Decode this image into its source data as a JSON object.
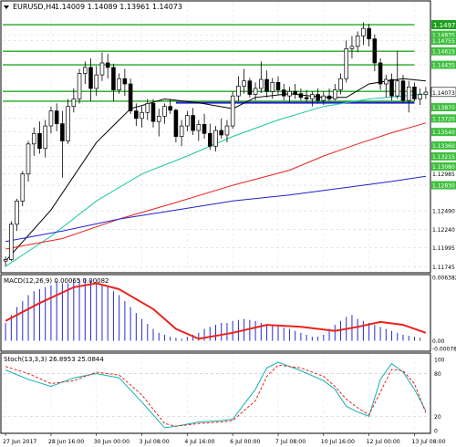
{
  "chart_data": [
    {
      "panel": "price",
      "type": "candlestick",
      "title": "EURUSD,H4",
      "ohlc_header": "1.14009 1.14089 1.13961 1.14073",
      "ylim": [
        1.117,
        1.1525
      ],
      "y_ticks": [
        {
          "value": 1.1497,
          "label": "1.1497",
          "style": "highlight"
        },
        {
          "value": 1.14835,
          "label": "1.14835",
          "style": "green"
        },
        {
          "value": 1.14755,
          "label": "1.14755",
          "style": "green"
        },
        {
          "value": 1.14615,
          "label": "1.14615",
          "style": "green"
        },
        {
          "value": 1.14435,
          "label": "1.14435",
          "style": "green"
        },
        {
          "value": 1.14073,
          "label": "1.14073",
          "style": "price"
        },
        {
          "value": 1.1387,
          "label": "1.13870",
          "style": "green"
        },
        {
          "value": 1.1372,
          "label": "1.13720",
          "style": "green"
        },
        {
          "value": 1.1354,
          "label": "1.13540",
          "style": "green"
        },
        {
          "value": 1.1336,
          "label": "1.13360",
          "style": "green"
        },
        {
          "value": 1.13215,
          "label": "1.13215",
          "style": "green"
        },
        {
          "value": 1.1308,
          "label": "1.13080",
          "style": "green"
        },
        {
          "value": 1.12985,
          "label": "1.12985",
          "style": "plain"
        },
        {
          "value": 1.1283,
          "label": "1.12830",
          "style": "green"
        },
        {
          "value": 1.1249,
          "label": "1.12490",
          "style": "plain"
        },
        {
          "value": 1.1224,
          "label": "1.12240",
          "style": "plain"
        },
        {
          "value": 1.11995,
          "label": "1.11995",
          "style": "plain"
        },
        {
          "value": 1.11745,
          "label": "1.11745",
          "style": "plain"
        }
      ],
      "candles": [
        [
          1.1182,
          1.1188,
          1.1175,
          1.1184
        ],
        [
          1.1184,
          1.1235,
          1.1182,
          1.1231
        ],
        [
          1.1231,
          1.1265,
          1.1222,
          1.1262
        ],
        [
          1.1262,
          1.1302,
          1.1255,
          1.1298
        ],
        [
          1.1298,
          1.1342,
          1.1288,
          1.1338
        ],
        [
          1.1338,
          1.136,
          1.1322,
          1.1352
        ],
        [
          1.1352,
          1.1368,
          1.1325,
          1.1332
        ],
        [
          1.1332,
          1.137,
          1.132,
          1.1362
        ],
        [
          1.1362,
          1.1388,
          1.1352,
          1.1382
        ],
        [
          1.1382,
          1.1392,
          1.1355,
          1.1365
        ],
        [
          1.1365,
          1.1382,
          1.1293,
          1.1342
        ],
        [
          1.1342,
          1.1398,
          1.1338,
          1.1388
        ],
        [
          1.1388,
          1.1412,
          1.138,
          1.1398
        ],
        [
          1.1398,
          1.1438,
          1.1392,
          1.1432
        ],
        [
          1.1432,
          1.1448,
          1.1418,
          1.144
        ],
        [
          1.144,
          1.1452,
          1.1395,
          1.1412
        ],
        [
          1.1412,
          1.1442,
          1.1402,
          1.143
        ],
        [
          1.143,
          1.146,
          1.1422,
          1.1446
        ],
        [
          1.1446,
          1.1458,
          1.1425,
          1.144
        ],
        [
          1.144,
          1.1445,
          1.1395,
          1.141
        ],
        [
          1.141,
          1.1432,
          1.1405,
          1.1425
        ],
        [
          1.1425,
          1.1438,
          1.1402,
          1.1418
        ],
        [
          1.1418,
          1.1425,
          1.1378,
          1.1382
        ],
        [
          1.1382,
          1.1392,
          1.1362,
          1.1372
        ],
        [
          1.1372,
          1.1388,
          1.136,
          1.138
        ],
        [
          1.138,
          1.1398,
          1.137,
          1.1392
        ],
        [
          1.1392,
          1.1398,
          1.136,
          1.1368
        ],
        [
          1.1368,
          1.1385,
          1.1348,
          1.1375
        ],
        [
          1.1375,
          1.1392,
          1.1365,
          1.1388
        ],
        [
          1.1388,
          1.1398,
          1.1378,
          1.1383
        ],
        [
          1.1383,
          1.1385,
          1.134,
          1.1348
        ],
        [
          1.1348,
          1.137,
          1.1335,
          1.1362
        ],
        [
          1.1362,
          1.1382,
          1.1355,
          1.1376
        ],
        [
          1.1376,
          1.1386,
          1.135,
          1.1356
        ],
        [
          1.1356,
          1.137,
          1.1342,
          1.1364
        ],
        [
          1.1364,
          1.1378,
          1.1345,
          1.1352
        ],
        [
          1.1352,
          1.1365,
          1.133,
          1.1335
        ],
        [
          1.1335,
          1.1362,
          1.1328,
          1.1356
        ],
        [
          1.1356,
          1.1372,
          1.1345,
          1.135
        ],
        [
          1.135,
          1.137,
          1.134,
          1.1362
        ],
        [
          1.1362,
          1.1408,
          1.1358,
          1.1402
        ],
        [
          1.1402,
          1.1428,
          1.1395,
          1.1415
        ],
        [
          1.1415,
          1.1438,
          1.1405,
          1.1422
        ],
        [
          1.1422,
          1.1426,
          1.14,
          1.1404
        ],
        [
          1.1404,
          1.142,
          1.1396,
          1.1412
        ],
        [
          1.1412,
          1.1448,
          1.1406,
          1.1424
        ],
        [
          1.1424,
          1.1436,
          1.14,
          1.1408
        ],
        [
          1.1408,
          1.1426,
          1.1398,
          1.142
        ],
        [
          1.142,
          1.1428,
          1.1404,
          1.141
        ],
        [
          1.141,
          1.1418,
          1.1396,
          1.1402
        ],
        [
          1.1402,
          1.1414,
          1.1393,
          1.1408
        ],
        [
          1.1408,
          1.1418,
          1.1398,
          1.1405
        ],
        [
          1.1405,
          1.1412,
          1.1396,
          1.14
        ],
        [
          1.14,
          1.141,
          1.1394,
          1.1398
        ],
        [
          1.1398,
          1.1408,
          1.1388,
          1.1404
        ],
        [
          1.1404,
          1.1412,
          1.1392,
          1.1396
        ],
        [
          1.1396,
          1.1408,
          1.139,
          1.1402
        ],
        [
          1.1402,
          1.1412,
          1.1395,
          1.1398
        ],
        [
          1.1398,
          1.1418,
          1.1396,
          1.141
        ],
        [
          1.141,
          1.1432,
          1.1404,
          1.1425
        ],
        [
          1.1425,
          1.1476,
          1.142,
          1.1465
        ],
        [
          1.1465,
          1.1482,
          1.1452,
          1.1468
        ],
        [
          1.1468,
          1.1488,
          1.146,
          1.1482
        ],
        [
          1.1482,
          1.15,
          1.147,
          1.1492
        ],
        [
          1.1492,
          1.1498,
          1.1468,
          1.1478
        ],
        [
          1.1478,
          1.1484,
          1.1435,
          1.1446
        ],
        [
          1.1446,
          1.1452,
          1.141,
          1.1418
        ],
        [
          1.1418,
          1.143,
          1.14,
          1.1424
        ],
        [
          1.1424,
          1.1432,
          1.1396,
          1.1402
        ],
        [
          1.1402,
          1.1462,
          1.1398,
          1.1422
        ],
        [
          1.1422,
          1.143,
          1.1392,
          1.1396
        ],
        [
          1.1396,
          1.1422,
          1.138,
          1.1414
        ],
        [
          1.1414,
          1.142,
          1.1395,
          1.1398
        ],
        [
          1.1398,
          1.1412,
          1.139,
          1.1404
        ],
        [
          1.1404,
          1.1414,
          1.1398,
          1.1407
        ]
      ],
      "lines": [
        {
          "name": "",
          "color": "#000000",
          "values": [
            [
              0,
              1.1182
            ],
            [
              8,
              1.125
            ],
            [
              16,
              1.134
            ],
            [
              22,
              1.1385
            ],
            [
              28,
              1.1398
            ],
            [
              34,
              1.1393
            ],
            [
              40,
              1.1385
            ],
            [
              44,
              1.14
            ],
            [
              50,
              1.1405
            ],
            [
              56,
              1.14
            ],
            [
              60,
              1.14
            ],
            [
              64,
              1.1418
            ],
            [
              70,
              1.1425
            ],
            [
              74,
              1.1422
            ]
          ]
        },
        {
          "name": "",
          "color": "#18c8a0",
          "values": [
            [
              0,
              1.1175
            ],
            [
              8,
              1.1215
            ],
            [
              16,
              1.1262
            ],
            [
              24,
              1.1298
            ],
            [
              32,
              1.1322
            ],
            [
              40,
              1.1348
            ],
            [
              48,
              1.137
            ],
            [
              56,
              1.1388
            ],
            [
              64,
              1.1398
            ],
            [
              70,
              1.1402
            ],
            [
              74,
              1.1405
            ]
          ]
        },
        {
          "name": "",
          "color": "#e8231c",
          "values": [
            [
              0,
              1.1198
            ],
            [
              10,
              1.1212
            ],
            [
              20,
              1.1238
            ],
            [
              30,
              1.126
            ],
            [
              40,
              1.1283
            ],
            [
              50,
              1.1303
            ],
            [
              56,
              1.1322
            ],
            [
              62,
              1.1338
            ],
            [
              68,
              1.1353
            ],
            [
              74,
              1.1366
            ]
          ]
        },
        {
          "name": "",
          "color": "#1e22cc",
          "values": [
            [
              0,
              1.1208
            ],
            [
              10,
              1.1222
            ],
            [
              20,
              1.1238
            ],
            [
              30,
              1.125
            ],
            [
              40,
              1.1262
            ],
            [
              50,
              1.127
            ],
            [
              60,
              1.128
            ],
            [
              68,
              1.1288
            ],
            [
              74,
              1.1295
            ]
          ]
        }
      ],
      "h_lines": [
        {
          "value": 1.1497,
          "color": "#22a822"
        },
        {
          "value": 1.14615,
          "color": "#22a822"
        },
        {
          "value": 1.14435,
          "color": "#22a822"
        },
        {
          "value": 1.1408,
          "color": "#22a822"
        },
        {
          "value": 1.1395,
          "color": "#22a822"
        },
        {
          "value": 1.1393,
          "color": "#1e22cc"
        }
      ],
      "x_tick_labels": [
        "27 Jun 2017",
        "28 Jun 16:00",
        "30 Jun 00:00",
        "3 Jul 08:00",
        "4 Jul 16:00",
        "6 Jul 00:00",
        "7 Jul 08:00",
        "10 Jul 16:00",
        "12 Jul 00:00",
        "13 Jul 08:00"
      ]
    },
    {
      "panel": "macd",
      "type": "bar+line",
      "title": "MACD(12,26,9) 0.00065 0.00082",
      "ylim": [
        -0.00078,
        0.0064
      ],
      "y_ticks": [
        {
          "value": 0.006382,
          "label": "0.006382"
        },
        {
          "value": 0.0,
          "label": "0.00"
        },
        {
          "value": -0.000786,
          "label": "-0.000786"
        }
      ],
      "histogram": [
        0.0018,
        0.0026,
        0.0034,
        0.004,
        0.0046,
        0.005,
        0.0052,
        0.0054,
        0.0056,
        0.006,
        0.0058,
        0.0058,
        0.006,
        0.0062,
        0.0063,
        0.0061,
        0.0059,
        0.0057,
        0.0054,
        0.005,
        0.0046,
        0.004,
        0.0034,
        0.0028,
        0.0022,
        0.0017,
        0.0012,
        0.0008,
        0.0006,
        0.0004,
        0.0003,
        0.0002,
        0.0004,
        0.0006,
        0.0008,
        0.0012,
        0.0014,
        0.0016,
        0.0018,
        0.0018,
        0.002,
        0.0021,
        0.0022,
        0.0021,
        0.002,
        0.0018,
        0.0017,
        0.0016,
        0.0015,
        0.0013,
        0.0012,
        0.001,
        0.0008,
        0.0006,
        0.0004,
        0.0004,
        0.0006,
        0.0012,
        0.0016,
        0.002,
        0.0024,
        0.0026,
        0.0022,
        0.002,
        0.0018,
        0.0016,
        0.0014,
        0.0012,
        0.001,
        0.0008,
        0.0006,
        0.0005,
        0.0004,
        0.0003
      ],
      "signal": [
        [
          0,
          0.002
        ],
        [
          6,
          0.0038
        ],
        [
          12,
          0.0054
        ],
        [
          16,
          0.0058
        ],
        [
          20,
          0.0052
        ],
        [
          26,
          0.0032
        ],
        [
          30,
          0.0012
        ],
        [
          34,
          0.0002
        ],
        [
          40,
          0.0008
        ],
        [
          46,
          0.0016
        ],
        [
          52,
          0.0014
        ],
        [
          58,
          0.001
        ],
        [
          62,
          0.0014
        ],
        [
          66,
          0.0019
        ],
        [
          70,
          0.0016
        ],
        [
          74,
          0.0008
        ]
      ]
    },
    {
      "panel": "stochastic",
      "type": "line",
      "title": "Stoch(13,3,3) 26.8953 25.0844",
      "ylim": [
        0,
        105
      ],
      "y_ticks": [
        {
          "value": 100,
          "label": "100"
        },
        {
          "value": 80,
          "label": "80"
        },
        {
          "value": 20,
          "label": "20"
        },
        {
          "value": 0,
          "label": "0"
        }
      ],
      "main": [
        [
          0,
          85
        ],
        [
          4,
          72
        ],
        [
          8,
          62
        ],
        [
          12,
          74
        ],
        [
          16,
          80
        ],
        [
          20,
          74
        ],
        [
          24,
          40
        ],
        [
          26,
          22
        ],
        [
          28,
          4
        ],
        [
          30,
          6
        ],
        [
          34,
          12
        ],
        [
          38,
          14
        ],
        [
          40,
          16
        ],
        [
          44,
          58
        ],
        [
          46,
          88
        ],
        [
          48,
          96
        ],
        [
          52,
          84
        ],
        [
          56,
          70
        ],
        [
          58,
          58
        ],
        [
          60,
          34
        ],
        [
          62,
          26
        ],
        [
          64,
          20
        ],
        [
          66,
          72
        ],
        [
          68,
          94
        ],
        [
          70,
          82
        ],
        [
          72,
          58
        ],
        [
          74,
          28
        ]
      ],
      "signal": [
        [
          0,
          90
        ],
        [
          4,
          80
        ],
        [
          8,
          66
        ],
        [
          12,
          70
        ],
        [
          16,
          82
        ],
        [
          20,
          78
        ],
        [
          24,
          50
        ],
        [
          26,
          30
        ],
        [
          28,
          10
        ],
        [
          30,
          6
        ],
        [
          34,
          10
        ],
        [
          38,
          12
        ],
        [
          40,
          14
        ],
        [
          44,
          42
        ],
        [
          46,
          76
        ],
        [
          48,
          92
        ],
        [
          52,
          88
        ],
        [
          56,
          76
        ],
        [
          58,
          62
        ],
        [
          60,
          44
        ],
        [
          62,
          32
        ],
        [
          64,
          22
        ],
        [
          66,
          54
        ],
        [
          68,
          86
        ],
        [
          70,
          84
        ],
        [
          72,
          66
        ],
        [
          74,
          25
        ]
      ]
    }
  ]
}
